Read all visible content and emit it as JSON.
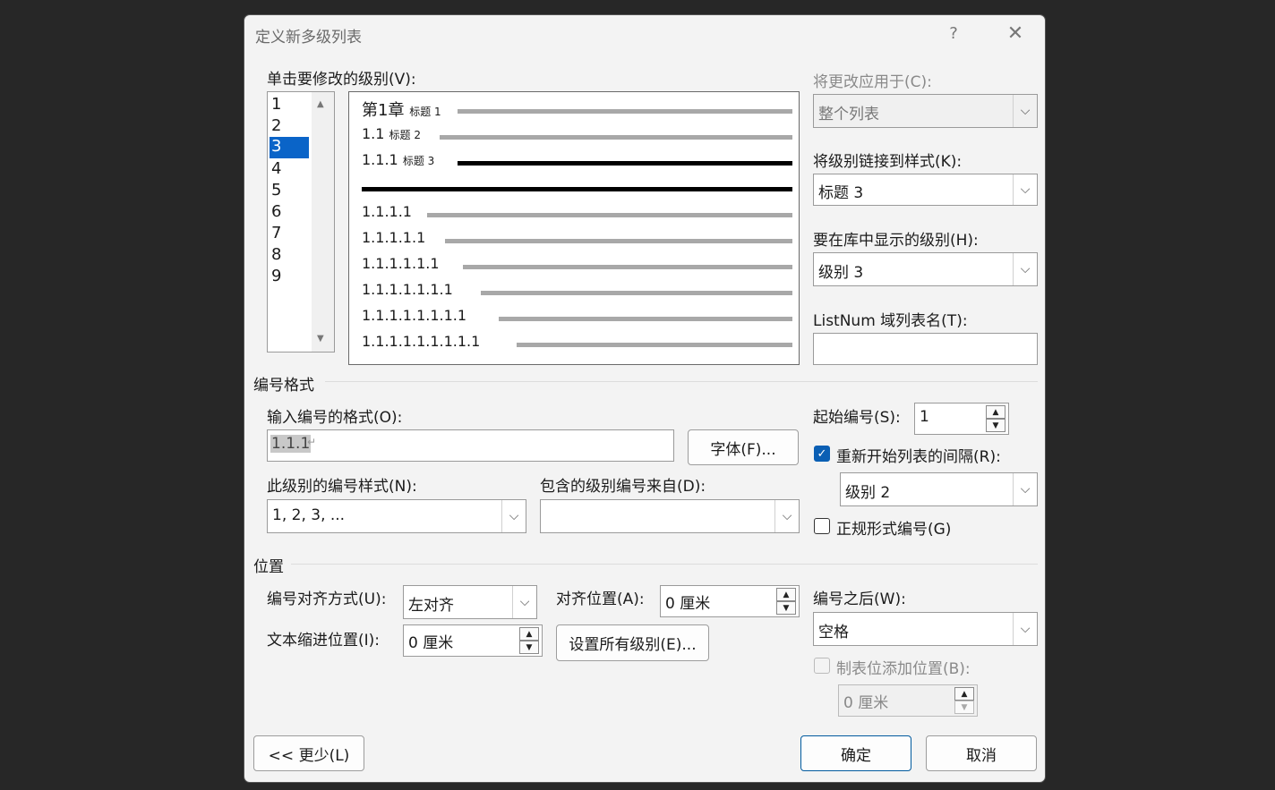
{
  "dialog": {
    "title": "定义新多级列表",
    "help_label": "?",
    "close_label": "✕"
  },
  "level_select": {
    "label": "单击要修改的级别(V):",
    "items": [
      "1",
      "2",
      "3",
      "4",
      "5",
      "6",
      "7",
      "8",
      "9"
    ],
    "selected": "3"
  },
  "preview": {
    "rows": [
      {
        "num": "第1章",
        "style": "标题 1"
      },
      {
        "num": "1.1",
        "style": "标题 2"
      },
      {
        "num": "1.1.1",
        "style": "标题 3"
      },
      {
        "num": "1.1.1.1",
        "style": ""
      },
      {
        "num": "1.1.1.1.1",
        "style": ""
      },
      {
        "num": "1.1.1.1.1.1",
        "style": ""
      },
      {
        "num": "1.1.1.1.1.1.1",
        "style": ""
      },
      {
        "num": "1.1.1.1.1.1.1.1",
        "style": ""
      },
      {
        "num": "1.1.1.1.1.1.1.1.1",
        "style": ""
      }
    ]
  },
  "right_panel": {
    "apply_to_label": "将更改应用于(C):",
    "apply_to_value": "整个列表",
    "link_style_label": "将级别链接到样式(K):",
    "link_style_value": "标题 3",
    "gallery_level_label": "要在库中显示的级别(H):",
    "gallery_level_value": "级别 3",
    "listnum_label": "ListNum 域列表名(T):",
    "listnum_value": ""
  },
  "number_format": {
    "section_title": "编号格式",
    "enter_format_label": "输入编号的格式(O):",
    "format_value": "1.1.1",
    "font_button": "字体(F)...",
    "style_label": "此级别的编号样式(N):",
    "style_value": "1, 2, 3, ...",
    "include_label": "包含的级别编号来自(D):",
    "include_value": "",
    "start_label": "起始编号(S):",
    "start_value": "1",
    "restart_label": "重新开始列表的间隔(R):",
    "restart_checked": true,
    "restart_value": "级别 2",
    "legal_label": "正规形式编号(G)",
    "legal_checked": false
  },
  "position": {
    "section_title": "位置",
    "align_label": "编号对齐方式(U):",
    "align_value": "左对齐",
    "align_at_label": "对齐位置(A):",
    "align_at_value": "0 厘米",
    "indent_label": "文本缩进位置(I):",
    "indent_value": "0 厘米",
    "set_all_button": "设置所有级别(E)...",
    "follow_label": "编号之后(W):",
    "follow_value": "空格",
    "tab_stop_label": "制表位添加位置(B):",
    "tab_stop_value": "0 厘米"
  },
  "footer": {
    "less_button": "<< 更少(L)",
    "ok_button": "确定",
    "cancel_button": "取消"
  },
  "colors": {
    "selection": "#0a64c8",
    "dialog_bg": "#f3f3f3",
    "backdrop": "#272727"
  }
}
